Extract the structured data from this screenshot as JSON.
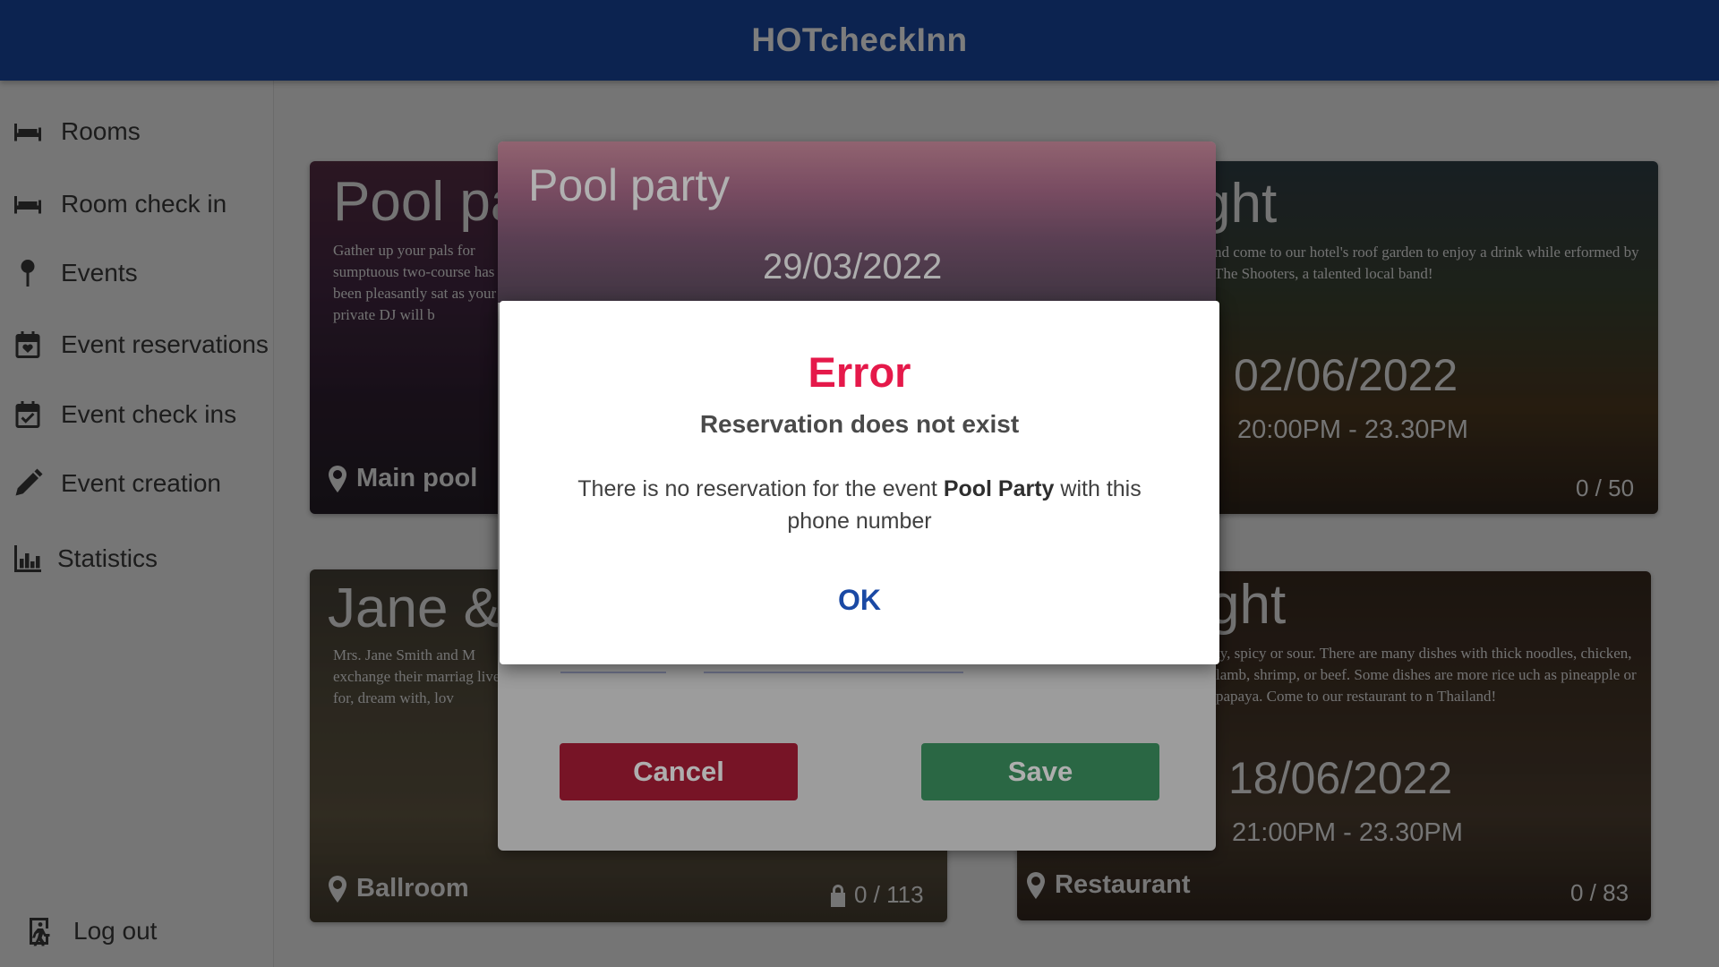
{
  "app": {
    "title": "HOTcheckInn",
    "brand_color": "#1a49a4"
  },
  "sidebar": {
    "items": [
      {
        "label": "Rooms",
        "icon": "bed-icon"
      },
      {
        "label": "Room check in",
        "icon": "bed-icon"
      },
      {
        "label": "Events",
        "icon": "map-pin-icon"
      },
      {
        "label": "Event reservations",
        "icon": "calendar-heart-icon"
      },
      {
        "label": "Event check ins",
        "icon": "calendar-check-icon"
      },
      {
        "label": "Event creation",
        "icon": "pencil-icon"
      },
      {
        "label": "Statistics",
        "icon": "bar-chart-icon"
      }
    ],
    "logout": {
      "label": "Log out",
      "icon": "exit-icon"
    }
  },
  "cards": [
    {
      "title": "Pool pa",
      "description": "Gather up your pals for sumptuous two-course has been pleasantly sat as your private DJ will b",
      "location": "Main pool"
    },
    {
      "title": "ght",
      "description": "nd come to our hotel's roof garden to enjoy a drink while erformed by The Shooters, a talented local band!",
      "date": "02/06/2022",
      "time": "20:00PM - 23.30PM",
      "capacity": "0 / 50"
    },
    {
      "title": "Jane &",
      "description": "Mrs. Jane Smith and M exchange their marriag live for, dream with, lov",
      "location": "Ballroom",
      "capacity": "0 / 113"
    },
    {
      "title": "ght",
      "description": "ty, spicy or sour. There are many dishes with thick noodles, chicken, lamb, shrimp, or beef. Some dishes are more rice uch as pineapple or papaya. Come to our restaurant to n Thailand!",
      "date": "18/06/2022",
      "time": "21:00PM - 23.30PM",
      "location": "Restaurant",
      "capacity": "0 / 83"
    }
  ],
  "reservation_modal": {
    "title": "Pool party",
    "date": "29/03/2022",
    "cancel_label": "Cancel",
    "save_label": "Save",
    "colors": {
      "cancel": "#a61d35",
      "save": "#3b8f5f"
    }
  },
  "error_dialog": {
    "heading": "Error",
    "subheading": "Reservation does not exist",
    "message_before": "There is no reservation for the event ",
    "message_event": "Pool Party",
    "message_after": " with this phone number",
    "ok_label": "OK",
    "heading_color": "#e5194a"
  }
}
